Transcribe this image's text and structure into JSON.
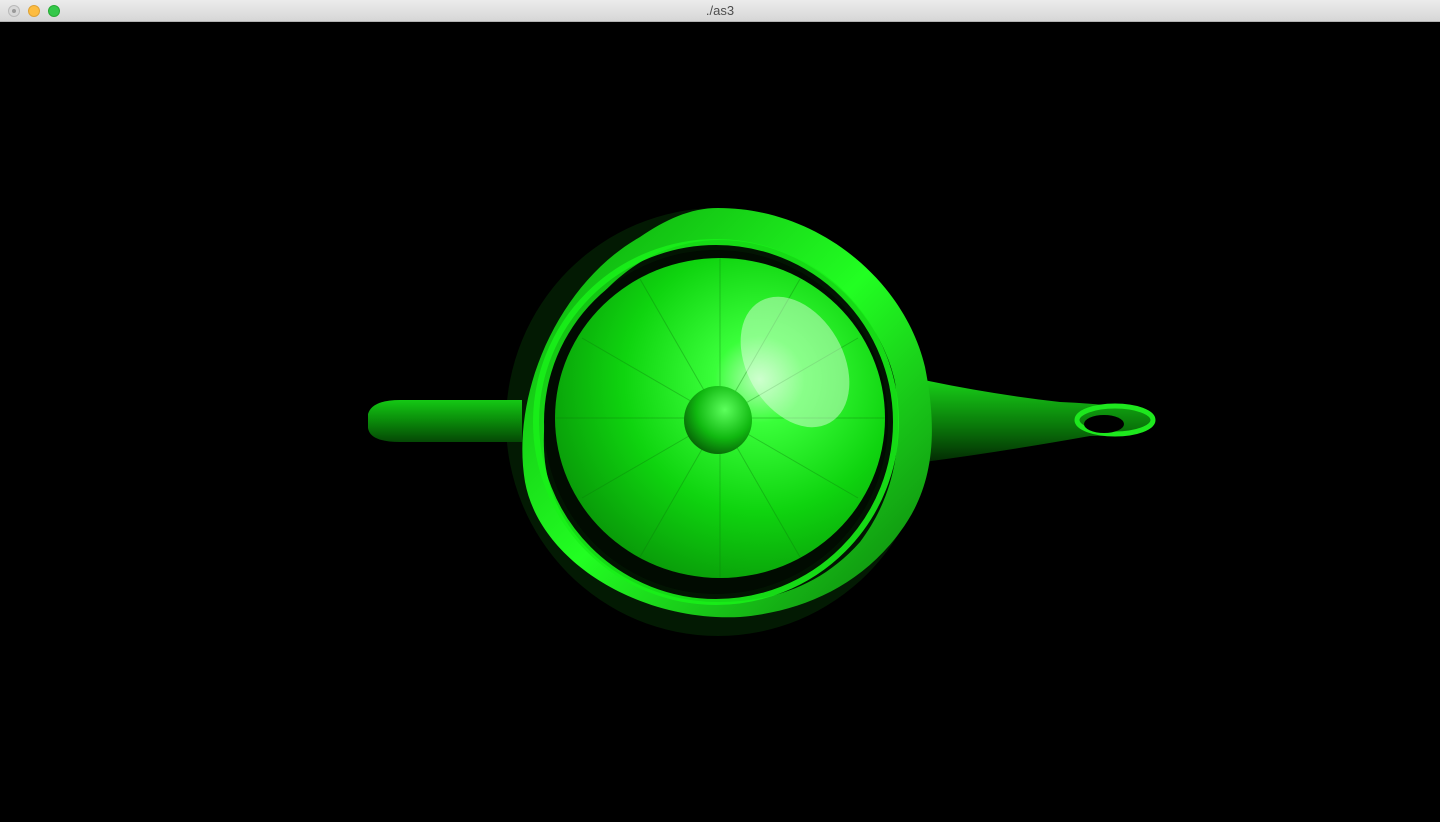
{
  "window": {
    "title": "./as3"
  },
  "scene": {
    "background": "#000000",
    "object_color": "#00ff00",
    "highlight_color": "#ffffff"
  },
  "icons": {
    "close": "close-button",
    "minimize": "minimize-button",
    "zoom": "zoom-button"
  }
}
